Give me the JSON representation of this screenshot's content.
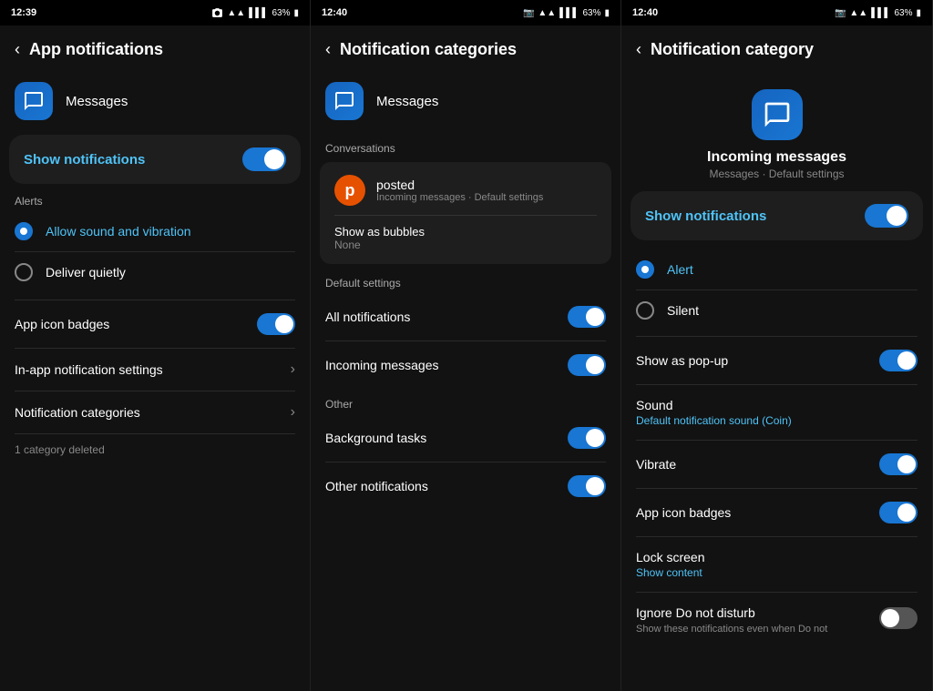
{
  "panels": [
    {
      "id": "panel1",
      "statusBar": {
        "time": "12:39",
        "icons": [
          "camera",
          "wifi",
          "signal",
          "battery"
        ],
        "battery": "63%"
      },
      "header": {
        "backLabel": "‹",
        "title": "App notifications"
      },
      "appRow": {
        "appName": "Messages"
      },
      "showNotifications": {
        "label": "Show notifications",
        "enabled": true
      },
      "alertsSection": {
        "label": "Alerts",
        "options": [
          {
            "label": "Allow sound and vibration",
            "selected": true
          },
          {
            "label": "Deliver quietly",
            "selected": false
          }
        ]
      },
      "items": [
        {
          "label": "App icon badges",
          "hasToggle": true,
          "toggleOn": true
        },
        {
          "label": "In-app notification settings",
          "hasToggle": false
        },
        {
          "label": "Notification categories",
          "hasToggle": false
        }
      ],
      "bottomNote": "1 category deleted"
    },
    {
      "id": "panel2",
      "statusBar": {
        "time": "12:40",
        "battery": "63%"
      },
      "header": {
        "backLabel": "‹",
        "title": "Notification categories"
      },
      "appRow": {
        "appName": "Messages"
      },
      "conversationsSection": {
        "label": "Conversations",
        "card": {
          "avatarInitial": "p",
          "name": "posted",
          "sub": "Incoming messages · Default settings"
        },
        "showAsBubbles": {
          "label": "Show as bubbles",
          "value": "None"
        }
      },
      "defaultSection": {
        "label": "Default settings",
        "items": [
          {
            "label": "All notifications",
            "toggleOn": true
          },
          {
            "label": "Incoming messages",
            "toggleOn": true
          }
        ]
      },
      "otherSection": {
        "label": "Other",
        "items": [
          {
            "label": "Background tasks",
            "toggleOn": true
          },
          {
            "label": "Other notifications",
            "toggleOn": true
          }
        ]
      }
    },
    {
      "id": "panel3",
      "statusBar": {
        "time": "12:40",
        "battery": "63%"
      },
      "header": {
        "backLabel": "‹",
        "title": "Notification category"
      },
      "categoryInfo": {
        "title": "Incoming messages",
        "sub": "Messages · Default settings"
      },
      "showNotifications": {
        "label": "Show notifications",
        "enabled": true
      },
      "alertOptions": [
        {
          "label": "Alert",
          "selected": true
        },
        {
          "label": "Silent",
          "selected": false
        }
      ],
      "showAsPopup": {
        "label": "Show as pop-up",
        "toggleOn": true
      },
      "sound": {
        "label": "Sound",
        "sub": "Default notification sound (Coin)"
      },
      "vibrate": {
        "label": "Vibrate",
        "toggleOn": true
      },
      "appIconBadges": {
        "label": "App icon badges",
        "toggleOn": true
      },
      "lockScreen": {
        "label": "Lock screen",
        "sub": "Show content"
      },
      "ignoreDoNotDisturb": {
        "label": "Ignore Do not disturb",
        "sub": "Show these notifications even when Do not",
        "toggleOn": false
      }
    }
  ]
}
